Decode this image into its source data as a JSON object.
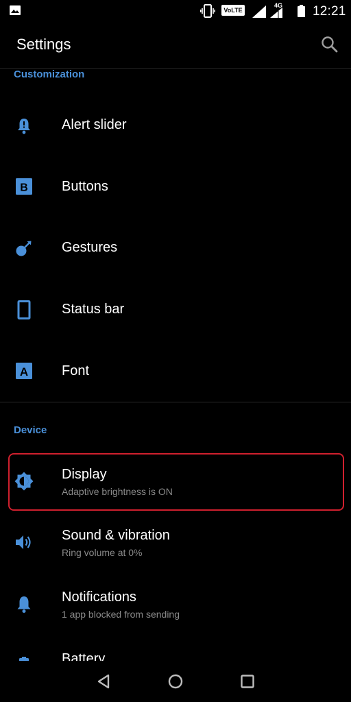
{
  "status_bar": {
    "time": "12:21",
    "volte_label": "VoLTE",
    "network_label": "4G",
    "icons": [
      "image-notification-icon",
      "vibrate-icon",
      "volte-icon",
      "signal-icon",
      "network-4g-icon",
      "battery-icon"
    ]
  },
  "toolbar": {
    "title": "Settings",
    "search_icon": "search-icon"
  },
  "sections": {
    "customization": {
      "header": "Customization",
      "items": [
        {
          "title": "Alert slider",
          "icon": "alert-slider-icon"
        },
        {
          "title": "Buttons",
          "icon": "buttons-icon"
        },
        {
          "title": "Gestures",
          "icon": "gestures-icon"
        },
        {
          "title": "Status bar",
          "icon": "status-bar-icon"
        },
        {
          "title": "Font",
          "icon": "font-icon"
        }
      ]
    },
    "device": {
      "header": "Device",
      "items": [
        {
          "title": "Display",
          "subtitle": "Adaptive brightness is ON",
          "icon": "display-icon",
          "highlighted": true
        },
        {
          "title": "Sound & vibration",
          "subtitle": "Ring volume at 0%",
          "icon": "sound-icon"
        },
        {
          "title": "Notifications",
          "subtitle": "1 app blocked from sending",
          "icon": "notifications-icon"
        },
        {
          "title": "Battery",
          "icon": "battery-icon"
        }
      ]
    }
  },
  "nav_bar": {
    "buttons": [
      "back-icon",
      "home-icon",
      "recents-icon"
    ]
  },
  "colors": {
    "accent": "#4a90d9",
    "background": "#000000",
    "highlight_border": "#d0202e",
    "subtitle": "#8a8a8a"
  }
}
